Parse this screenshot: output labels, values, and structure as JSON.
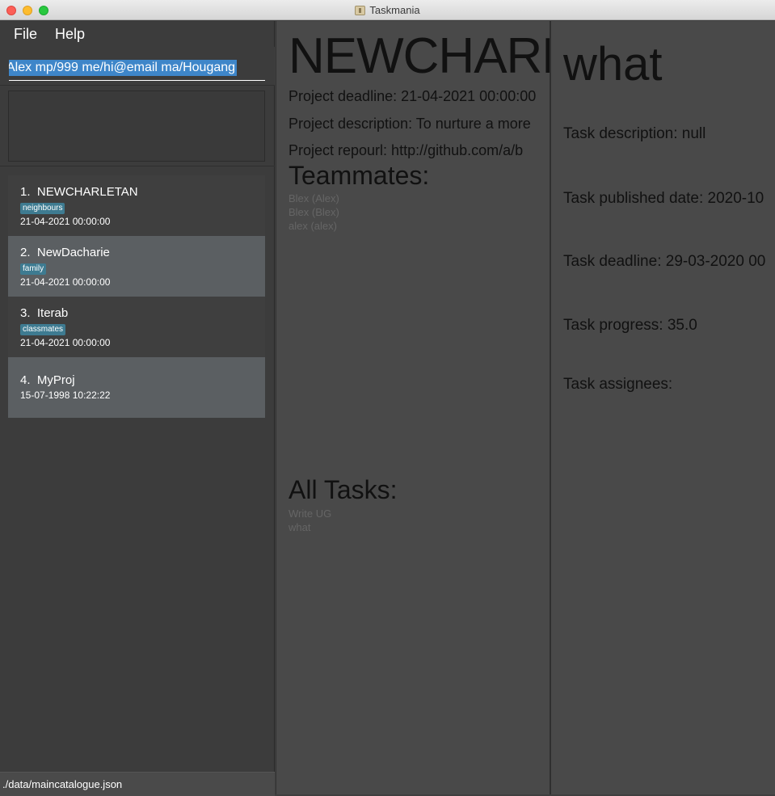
{
  "window": {
    "title": "Taskmania"
  },
  "menu": {
    "file": "File",
    "help": "Help"
  },
  "command": {
    "value": "Alex mp/999 me/hi@email ma/Hougang"
  },
  "projects": [
    {
      "index": "1.",
      "name": "NEWCHARLETAN",
      "tag": "neighbours",
      "deadline": "21-04-2021 00:00:00"
    },
    {
      "index": "2.",
      "name": "NewDacharie",
      "tag": "family",
      "deadline": "21-04-2021 00:00:00"
    },
    {
      "index": "3.",
      "name": "Iterab",
      "tag": "classmates",
      "deadline": "21-04-2021 00:00:00"
    },
    {
      "index": "4.",
      "name": "MyProj",
      "tag": "",
      "deadline": "15-07-1998 10:22:22"
    }
  ],
  "status": {
    "path": "./data/maincatalogue.json"
  },
  "project_detail": {
    "title": "NEWCHARLETAN",
    "deadline": "Project deadline: 21-04-2021 00:00:00",
    "description": "Project description: To nurture a more",
    "repourl": "Project repourl: http://github.com/a/b",
    "teammates_heading": "Teammates:",
    "teammates": [
      "Blex (Alex)",
      "Blex (Blex)",
      "alex (alex)"
    ],
    "tasks_heading": "All Tasks:",
    "tasks": [
      "Write UG",
      "what"
    ]
  },
  "task_detail": {
    "title": "what",
    "description": "Task description: null",
    "published": "Task published date: 2020-10",
    "deadline": "Task deadline: 29-03-2020 00",
    "progress": "Task progress: 35.0",
    "assignees": "Task assignees:"
  },
  "colors": {
    "panel_bg": "#494949",
    "left_bg": "#3c3c3c",
    "selected_card": "#5b5f62",
    "tag_bg": "#3e7b91",
    "selection": "#3e86c9"
  }
}
